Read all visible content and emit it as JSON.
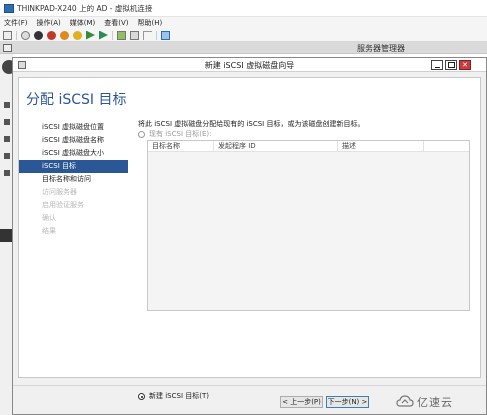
{
  "vm_window": {
    "title": "THINKPAD-X240 上的 AD - 虚拟机连接",
    "menu": [
      "文件(F)",
      "操作(A)",
      "媒体(M)",
      "查看(V)",
      "帮助(H)"
    ]
  },
  "server_manager": {
    "title": "服务器管理器"
  },
  "wizard": {
    "title": "新建 iSCSI 虚拟磁盘向导",
    "heading": "分配 iSCSI 目标",
    "steps": [
      {
        "label": "iSCSI 虚拟磁盘位置",
        "state": "normal"
      },
      {
        "label": "iSCSI 虚拟磁盘名称",
        "state": "normal"
      },
      {
        "label": "iSCSI 虚拟磁盘大小",
        "state": "normal"
      },
      {
        "label": "iSCSI 目标",
        "state": "active"
      },
      {
        "label": "目标名称和访问",
        "state": "normal"
      },
      {
        "label": "访问服务器",
        "state": "disabled"
      },
      {
        "label": "启用验证服务",
        "state": "disabled"
      },
      {
        "label": "确认",
        "state": "disabled"
      },
      {
        "label": "结果",
        "state": "disabled"
      }
    ],
    "description": "将此 iSCSI 虚拟磁盘分配给现有的 iSCSI 目标，或为该磁盘创建新目标。",
    "existing_target_label": "现有 iSCSI 目标(E):",
    "table_columns": [
      "目标名称",
      "发起程序 ID",
      "描述",
      ""
    ],
    "new_target_label": "新建 iSCSI 目标(T)",
    "selected_option": "new",
    "buttons": {
      "prev": "< 上一步(P)",
      "next": "下一步(N) >"
    }
  },
  "watermark": {
    "text": "亿速云"
  },
  "colors": {
    "accent": "#2b5797",
    "heading": "#2b5797"
  }
}
